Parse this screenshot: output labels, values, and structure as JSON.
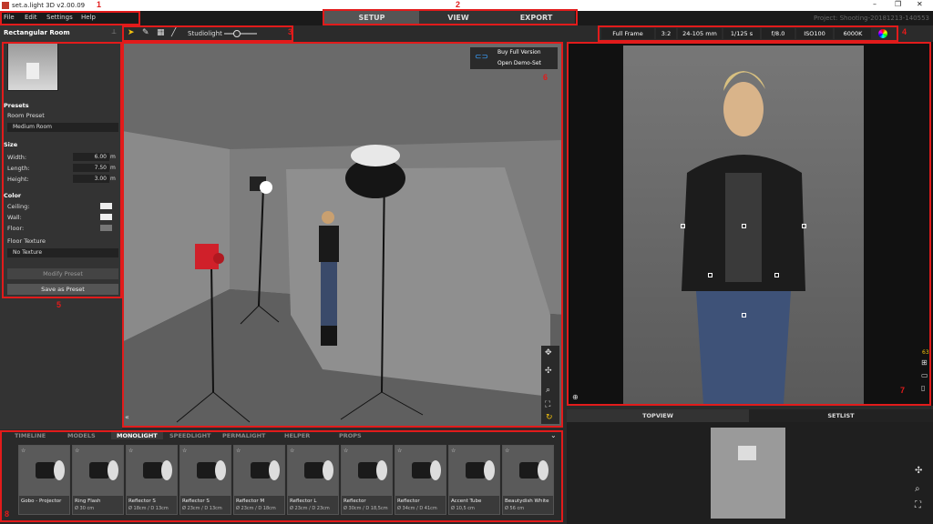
{
  "app": {
    "title": "set.a.light 3D v2.00.09"
  },
  "menu": [
    "File",
    "Edit",
    "Settings",
    "Help"
  ],
  "top_tabs": [
    "SETUP",
    "VIEW",
    "EXPORT"
  ],
  "active_tab": "SETUP",
  "project": "Project: Shooting-20181213-140553",
  "callouts": [
    "1",
    "2",
    "3",
    "4",
    "5",
    "6",
    "7",
    "8"
  ],
  "left_panel": {
    "title": "Rectangular Room",
    "presets_header": "Presets",
    "room_preset_label": "Room Preset",
    "room_preset_value": "Medium Room",
    "size_header": "Size",
    "width_label": "Width:",
    "width_value": "6.00",
    "length_label": "Length:",
    "length_value": "7.50",
    "height_label": "Height:",
    "height_value": "3.00",
    "unit": "m",
    "color_header": "Color",
    "ceiling_label": "Ceiling:",
    "wall_label": "Wall:",
    "floor_label": "Floor:",
    "floor_texture_label": "Floor Texture",
    "floor_texture_value": "No Texture",
    "modify_preset": "Modify Preset",
    "save_preset": "Save as Preset"
  },
  "toolbar": {
    "studiolight_label": "Studiolight",
    "studiolight_level": 0.4
  },
  "viewport": {
    "buy": "Buy Full Version",
    "demo": "Open Demo-Set"
  },
  "camera": {
    "format": "Full Frame",
    "ratio": "3:2",
    "lens": "24-105 mm",
    "shutter": "1/125 s",
    "aperture": "f/8.0",
    "iso": "ISO100",
    "wb": "6000K",
    "focal_readout": "63"
  },
  "bottom_right_tabs": [
    "TOPVIEW",
    "SETLIST"
  ],
  "light_tabs": [
    "TIMELINE",
    "MODELS",
    "MONOLIGHT",
    "SPEEDLIGHT",
    "PERMALIGHT",
    "HELPER",
    "PROPS"
  ],
  "active_light_tab": "MONOLIGHT",
  "lights": [
    {
      "name": "Gobo - Projector",
      "size": ""
    },
    {
      "name": "Ring Flash",
      "size": "Ø 30 cm"
    },
    {
      "name": "Reflector S",
      "size": "Ø 18cm / D 13cm"
    },
    {
      "name": "Reflector S",
      "size": "Ø 23cm / D 13cm"
    },
    {
      "name": "Reflector M",
      "size": "Ø 23cm / D 18cm"
    },
    {
      "name": "Reflector L",
      "size": "Ø 23cm / D 23cm"
    },
    {
      "name": "Reflector",
      "size": "Ø 30cm / D 18,5cm"
    },
    {
      "name": "Reflector",
      "size": "Ø 34cm / D 41cm"
    },
    {
      "name": "Accent Tube",
      "size": "Ø 10,5 cm"
    },
    {
      "name": "Beautydish White",
      "size": "Ø 56 cm"
    }
  ],
  "colors": {
    "accent_red": "#e21b1b",
    "panel": "#333333"
  }
}
